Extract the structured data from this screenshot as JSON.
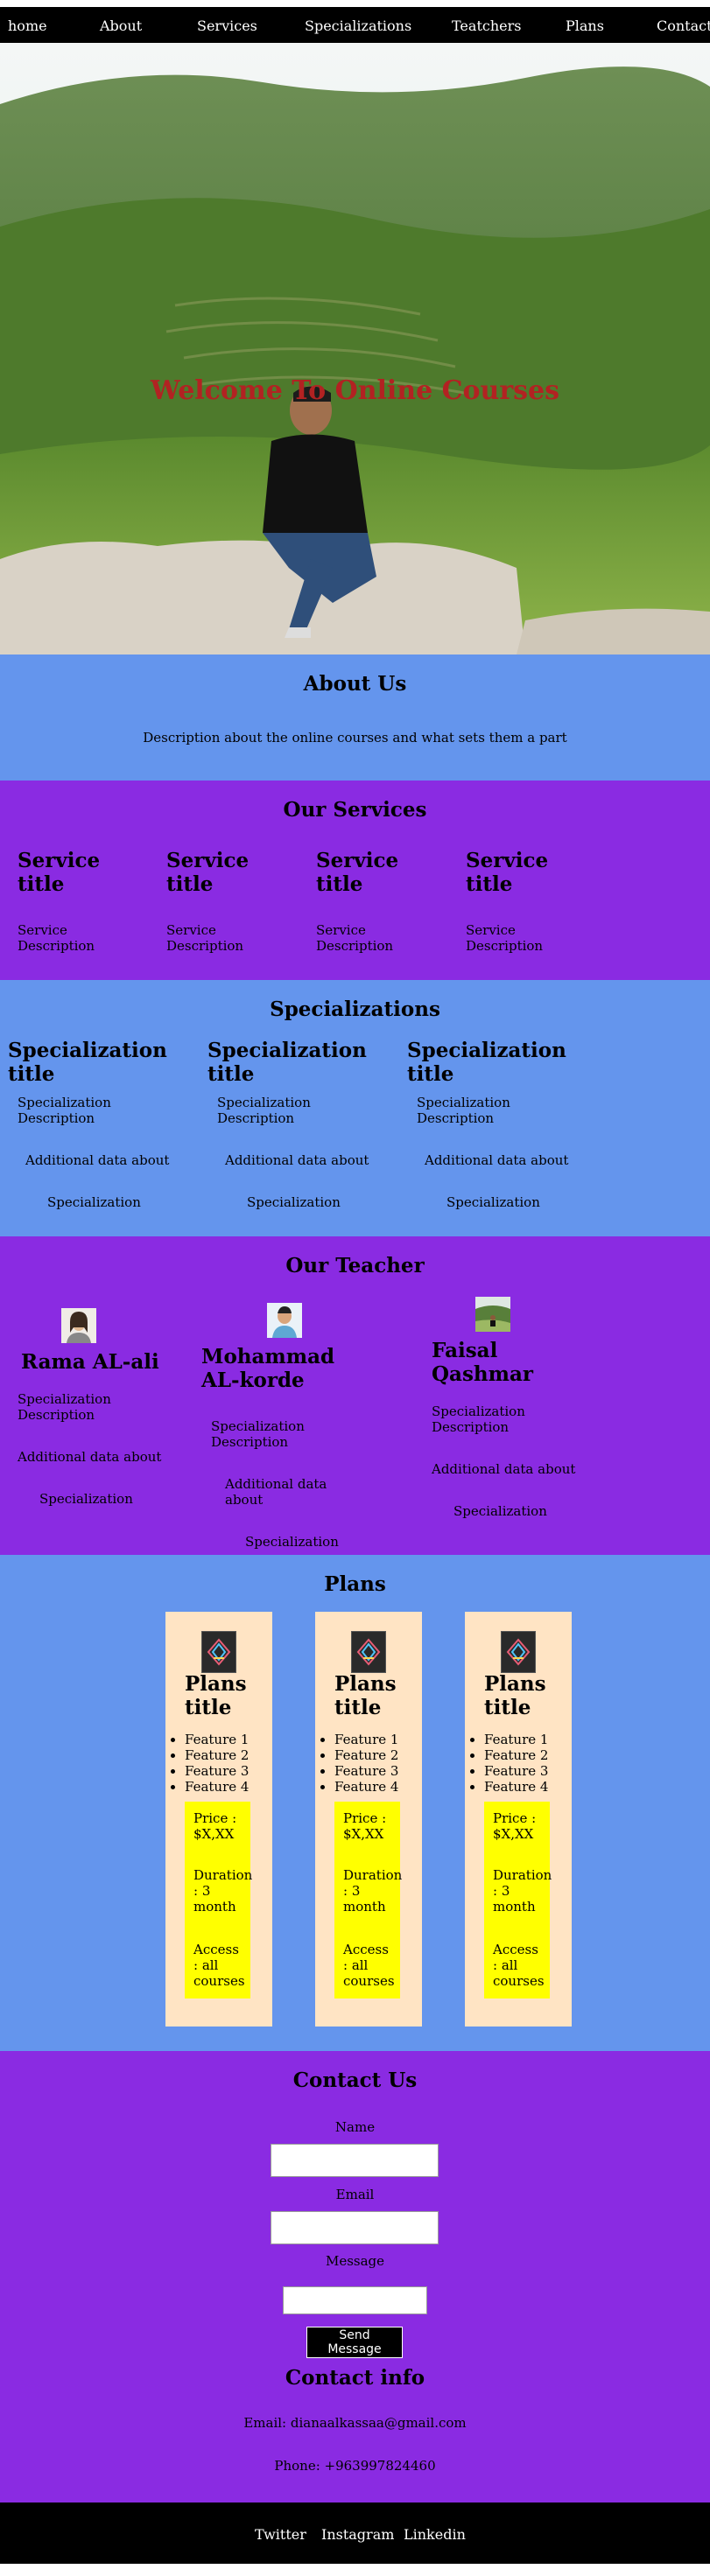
{
  "nav": {
    "items": [
      "home",
      "About",
      "Services",
      "Specializations",
      "Teatchers",
      "Plans",
      "Contact"
    ]
  },
  "hero": {
    "title": "Welcome To Online Courses"
  },
  "about": {
    "title": "About Us",
    "description": "Description about the online courses and what sets them a part"
  },
  "services": {
    "title": "Our Services",
    "items": [
      {
        "title": "Service title",
        "description": "Service Description"
      },
      {
        "title": "Service title",
        "description": "Service Description"
      },
      {
        "title": "Service title",
        "description": "Service Description"
      },
      {
        "title": "Service title",
        "description": "Service Description"
      }
    ]
  },
  "specializations": {
    "title": "Specializations",
    "items": [
      {
        "title": "Specialization title",
        "description": "Specialization Description",
        "additional": "Additional data about",
        "footer": "Specialization"
      },
      {
        "title": "Specialization title",
        "description": "Specialization Description",
        "additional": "Additional data about",
        "footer": "Specialization"
      },
      {
        "title": "Specialization title",
        "description": "Specialization Description",
        "additional": "Additional data about",
        "footer": "Specialization"
      }
    ]
  },
  "teachers": {
    "title": "Our Teacher",
    "items": [
      {
        "name": "Rama AL-ali",
        "description": "Specialization Description",
        "additional": "Additional data about",
        "footer": "Specialization",
        "avatar": "woman-avatar"
      },
      {
        "name": "Mohammad AL-korde",
        "description": "Specialization Description",
        "additional": "Additional data about",
        "footer": "Specialization",
        "avatar": "man-avatar"
      },
      {
        "name": "Faisal Qashmar",
        "description": "Specialization Description",
        "additional": "Additional data about",
        "footer": "Specialization",
        "avatar": "landscape-avatar"
      }
    ]
  },
  "plans": {
    "title": "Plans",
    "items": [
      {
        "title": "Plans title",
        "features": [
          "Feature 1",
          "Feature 2",
          "Feature 3",
          "Feature 4"
        ],
        "price": "Price : $X,XX",
        "duration": "Duration : 3 month",
        "access": "Access : all courses"
      },
      {
        "title": "Plans title",
        "features": [
          "Feature 1",
          "Feature 2",
          "Feature 3",
          "Feature 4"
        ],
        "price": "Price : $X,XX",
        "duration": "Duration : 3 month",
        "access": "Access : all courses"
      },
      {
        "title": "Plans title",
        "features": [
          "Feature 1",
          "Feature 2",
          "Feature 3",
          "Feature 4"
        ],
        "price": "Price : $X,XX",
        "duration": "Duration : 3 month",
        "access": "Access : all courses"
      }
    ]
  },
  "contact": {
    "title": "Contact Us",
    "name_label": "Name",
    "email_label": "Email",
    "message_label": "Message",
    "send_label": "Send Message",
    "info_title": "Contact info",
    "email": "Email: dianaalkassaa@gmail.com",
    "phone": "Phone: +963997824460"
  },
  "footer": {
    "links": [
      "Twitter",
      "Instagram",
      "Linkedin"
    ]
  },
  "colors": {
    "nav": "#000000",
    "blue_section": "#6495ed",
    "purple_section": "#8a2be2",
    "plan_card": "#ffe4c4",
    "plan_box": "#ffff00",
    "hero_title": "#b22222"
  }
}
